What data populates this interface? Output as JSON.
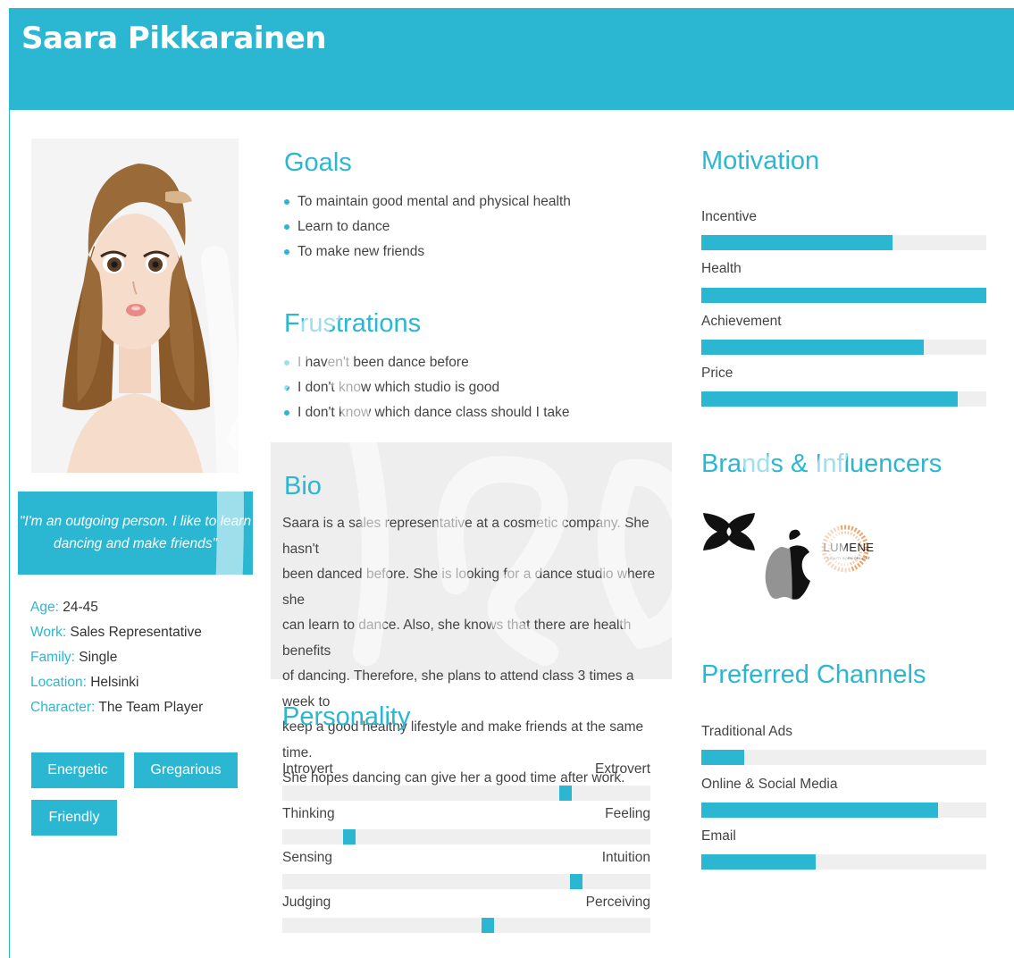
{
  "persona": {
    "name": "Saara Pikkarainen",
    "quote": "\"I'm an outgoing person. I like to learn dancing and make friends\"",
    "facts": [
      {
        "key": "Age:",
        "value": "24-45"
      },
      {
        "key": "Work:",
        "value": "Sales Representative"
      },
      {
        "key": "Family:",
        "value": "Single"
      },
      {
        "key": "Location:",
        "value": "Helsinki"
      },
      {
        "key": "Character:",
        "value": "The Team Player"
      }
    ],
    "tags": [
      "Energetic",
      "Gregarious",
      "Friendly"
    ]
  },
  "goals": {
    "title": "Goals",
    "items": [
      "To maintain good mental and physical health",
      "Learn to dance",
      "To make new friends"
    ]
  },
  "frustrations": {
    "title": "Frustrations",
    "items": [
      "I haven't been dance before",
      "I don't know which studio is good",
      "I don't know which dance class should I take"
    ]
  },
  "bio": {
    "title": "Bio",
    "lines": [
      "Saara is a sales representative at a cosmetic company. She hasn't",
      "been danced before. She is looking for a dance studio where she",
      "can learn to dance. Also, she knows that there are health benefits",
      "of dancing. Therefore, she plans to attend class 3 times a week to",
      "keep a good healthy lifestyle and make friends at the same time.",
      "She hopes dancing can give her a good time after work."
    ]
  },
  "personality": {
    "title": "Personality",
    "traits": [
      {
        "left": "Introvert",
        "right": "Extrovert",
        "value": 0.78
      },
      {
        "left": "Thinking",
        "right": "Feeling",
        "value": 0.17
      },
      {
        "left": "Sensing",
        "right": "Intuition",
        "value": 0.81
      },
      {
        "left": "Judging",
        "right": "Perceiving",
        "value": 0.56
      }
    ]
  },
  "motivation": {
    "title": "Motivation",
    "items": [
      {
        "label": "Incentive",
        "value": 0.67
      },
      {
        "label": "Health",
        "value": 1.0
      },
      {
        "label": "Achievement",
        "value": 0.78
      },
      {
        "label": "Price",
        "value": 0.9
      }
    ]
  },
  "brands": {
    "title": "Brands & Influencers",
    "logos": [
      {
        "name": "under-armour-logo"
      },
      {
        "name": "apple-logo"
      },
      {
        "name": "lumene-logo",
        "wordmark": "LUMENE",
        "tagline": "BEAUTY BORN OF LIGHT"
      }
    ]
  },
  "channels": {
    "title": "Preferred Channels",
    "items": [
      {
        "label": "Traditional Ads",
        "value": 0.15
      },
      {
        "label": "Online & Social Media",
        "value": 0.83
      },
      {
        "label": "Email",
        "value": 0.4
      }
    ]
  },
  "colors": {
    "accent": "#2bb7d2",
    "track": "#efefef",
    "text": "#444444"
  }
}
